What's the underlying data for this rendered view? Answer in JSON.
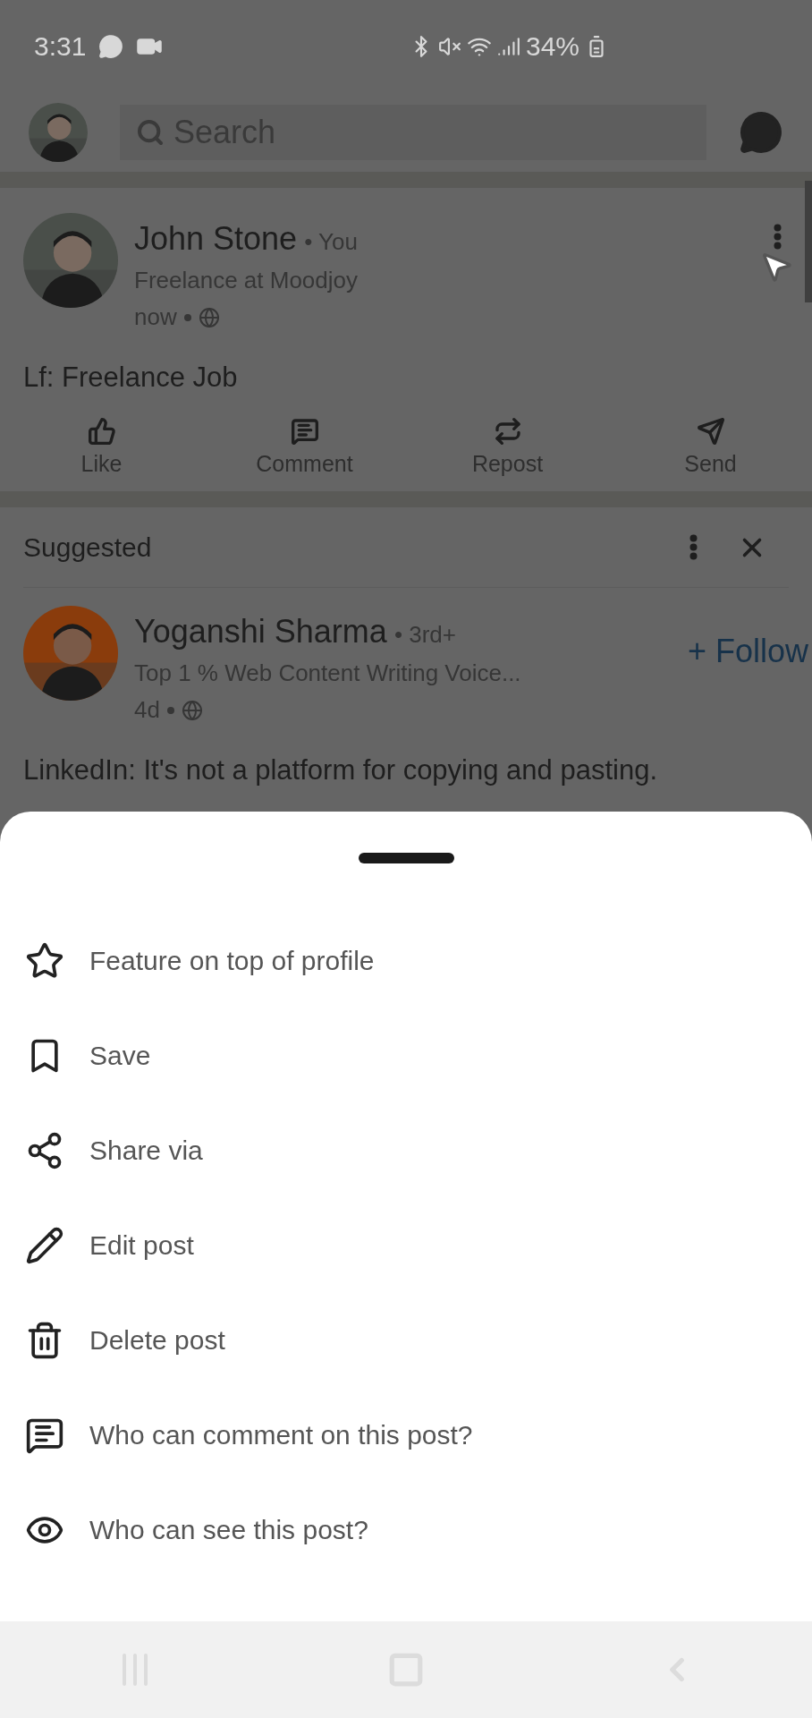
{
  "status_bar": {
    "time": "3:31",
    "battery": "34%"
  },
  "top_bar": {
    "search": {
      "placeholder": "Search"
    }
  },
  "post": {
    "author": "John Stone",
    "relation": "• You",
    "headline": "Freelance at Moodjoy",
    "time": "now",
    "text": "Lf: Freelance Job",
    "actions": [
      {
        "kind": "like",
        "label": "Like"
      },
      {
        "kind": "comment",
        "label": "Comment"
      },
      {
        "kind": "repost",
        "label": "Repost"
      },
      {
        "kind": "send",
        "label": "Send"
      }
    ]
  },
  "suggested": {
    "header": "Suggested",
    "author": "Yoganshi Sharma",
    "relation": "• 3rd+",
    "headline": "Top 1 % Web Content Writing Voice...",
    "time": "4d",
    "follow": "+ Follow",
    "text": "LinkedIn: It's not a platform for copying and pasting."
  },
  "sheet": {
    "items": [
      {
        "kind": "star",
        "label": "Feature on top of profile"
      },
      {
        "kind": "bookmark",
        "label": "Save"
      },
      {
        "kind": "share",
        "label": "Share via"
      },
      {
        "kind": "edit",
        "label": "Edit post"
      },
      {
        "kind": "delete",
        "label": "Delete post"
      },
      {
        "kind": "comment",
        "label": "Who can comment on this post?"
      },
      {
        "kind": "eye",
        "label": "Who can see this post?"
      }
    ]
  }
}
